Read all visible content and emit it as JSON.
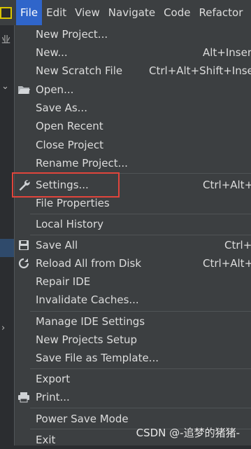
{
  "menubar": {
    "items": [
      "File",
      "Edit",
      "View",
      "Navigate",
      "Code",
      "Refactor"
    ],
    "left_glyph": "业"
  },
  "menu": {
    "items": [
      {
        "label": "New Project...",
        "shortcut": "",
        "icon": ""
      },
      {
        "label": "New...",
        "shortcut": "Alt+Insert",
        "icon": ""
      },
      {
        "label": "New Scratch File",
        "shortcut": "Ctrl+Alt+Shift+Insert",
        "icon": ""
      },
      {
        "label": "Open...",
        "shortcut": "",
        "icon": "folder-icon"
      },
      {
        "label": "Save As...",
        "shortcut": "",
        "icon": ""
      },
      {
        "label": "Open Recent",
        "shortcut": "",
        "icon": ""
      },
      {
        "label": "Close Project",
        "shortcut": "",
        "icon": ""
      },
      {
        "label": "Rename Project...",
        "shortcut": "",
        "icon": ""
      },
      {
        "label": "Settings...",
        "shortcut": "Ctrl+Alt+S",
        "icon": "wrench-icon"
      },
      {
        "label": "File Properties",
        "shortcut": "",
        "icon": ""
      },
      {
        "label": "Local History",
        "shortcut": "",
        "icon": ""
      },
      {
        "label": "Save All",
        "shortcut": "Ctrl+S",
        "icon": "save-icon"
      },
      {
        "label": "Reload All from Disk",
        "shortcut": "Ctrl+Alt+Y",
        "icon": "reload-icon"
      },
      {
        "label": "Repair IDE",
        "shortcut": "",
        "icon": ""
      },
      {
        "label": "Invalidate Caches...",
        "shortcut": "",
        "icon": ""
      },
      {
        "label": "Manage IDE Settings",
        "shortcut": "",
        "icon": ""
      },
      {
        "label": "New Projects Setup",
        "shortcut": "",
        "icon": ""
      },
      {
        "label": "Save File as Template...",
        "shortcut": "",
        "icon": ""
      },
      {
        "label": "Export",
        "shortcut": "",
        "icon": ""
      },
      {
        "label": "Print...",
        "shortcut": "",
        "icon": "print-icon"
      },
      {
        "label": "Power Save Mode",
        "shortcut": "",
        "icon": ""
      },
      {
        "label": "Exit",
        "shortcut": "",
        "icon": ""
      }
    ]
  },
  "highlight": {
    "color": "#e0453c"
  },
  "watermark": "CSDN @-追梦的猪猪-",
  "colors": {
    "menu_bg": "#3c3f41",
    "accent": "#2f65ca",
    "text": "#dcdcdc"
  }
}
